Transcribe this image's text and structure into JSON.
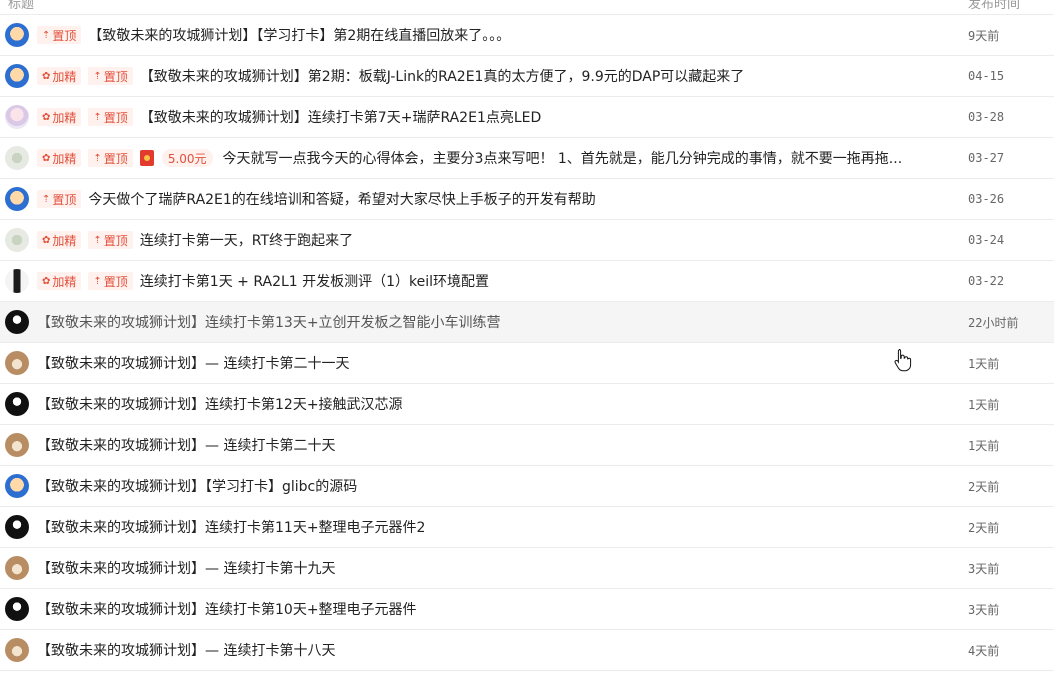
{
  "header": {
    "col_title": "标题",
    "col_time": "发布时间"
  },
  "badges": {
    "top": "置顶",
    "featured": "加精"
  },
  "rows": [
    {
      "avatar": "a-blue",
      "featured": false,
      "top": true,
      "amount": "",
      "title": "【致敬未来的攻城狮计划】【学习打卡】第2期在线直播回放来了。。。",
      "time": "9天前"
    },
    {
      "avatar": "a-blue",
      "featured": true,
      "top": true,
      "amount": "",
      "title": "【致敬未来的攻城狮计划】第2期：板载J-Link的RA2E1真的太方便了，9.9元的DAP可以藏起来了",
      "time": "04-15"
    },
    {
      "avatar": "a-anime",
      "featured": true,
      "top": true,
      "amount": "",
      "title": "【致敬未来的攻城狮计划】连续打卡第7天+瑞萨RA2E1点亮LED",
      "time": "03-28"
    },
    {
      "avatar": "a-blur",
      "featured": true,
      "top": true,
      "amount": "5.00元",
      "title": "今天就写一点我今天的心得体会，主要分3点来写吧！ 1、首先就是，能几分钟完成的事情，就不要一拖再拖...",
      "time": "03-27"
    },
    {
      "avatar": "a-blue",
      "featured": false,
      "top": true,
      "amount": "",
      "title": "今天做个了瑞萨RA2E1的在线培训和答疑，希望对大家尽快上手板子的开发有帮助",
      "time": "03-26"
    },
    {
      "avatar": "a-blur",
      "featured": true,
      "top": true,
      "amount": "",
      "title": "连续打卡第一天，RT终于跑起来了",
      "time": "03-24"
    },
    {
      "avatar": "a-tall",
      "featured": true,
      "top": true,
      "amount": "",
      "title": "连续打卡第1天 + RA2L1 开发板测评（1）keil环境配置",
      "time": "03-22"
    },
    {
      "avatar": "a-black",
      "featured": false,
      "top": false,
      "amount": "",
      "title": "【致敬未来的攻城狮计划】连续打卡第13天+立创开发板之智能小车训练营",
      "time": "22小时前",
      "hover": true
    },
    {
      "avatar": "a-dog",
      "featured": false,
      "top": false,
      "amount": "",
      "title": "【致敬未来的攻城狮计划】— 连续打卡第二十一天",
      "time": "1天前"
    },
    {
      "avatar": "a-black",
      "featured": false,
      "top": false,
      "amount": "",
      "title": "【致敬未来的攻城狮计划】连续打卡第12天+接触武汉芯源",
      "time": "1天前"
    },
    {
      "avatar": "a-dog",
      "featured": false,
      "top": false,
      "amount": "",
      "title": "【致敬未来的攻城狮计划】— 连续打卡第二十天",
      "time": "1天前"
    },
    {
      "avatar": "a-blue",
      "featured": false,
      "top": false,
      "amount": "",
      "title": "【致敬未来的攻城狮计划】【学习打卡】glibc的源码",
      "time": "2天前"
    },
    {
      "avatar": "a-black",
      "featured": false,
      "top": false,
      "amount": "",
      "title": "【致敬未来的攻城狮计划】连续打卡第11天+整理电子元器件2",
      "time": "2天前"
    },
    {
      "avatar": "a-dog",
      "featured": false,
      "top": false,
      "amount": "",
      "title": "【致敬未来的攻城狮计划】— 连续打卡第十九天",
      "time": "3天前"
    },
    {
      "avatar": "a-black",
      "featured": false,
      "top": false,
      "amount": "",
      "title": "【致敬未来的攻城狮计划】连续打卡第10天+整理电子元器件",
      "time": "3天前"
    },
    {
      "avatar": "a-dog",
      "featured": false,
      "top": false,
      "amount": "",
      "title": "【致敬未来的攻城狮计划】— 连续打卡第十八天",
      "time": "4天前"
    }
  ],
  "icons": {
    "top": "pin-icon",
    "featured": "flower-icon",
    "redpacket": "red-packet-icon",
    "cursor": "hand-cursor-icon"
  },
  "colors": {
    "badge_text": "#e2503a",
    "badge_bg": "#fff1ee",
    "border": "#ececec",
    "hover_bg": "#f5f5f5"
  }
}
